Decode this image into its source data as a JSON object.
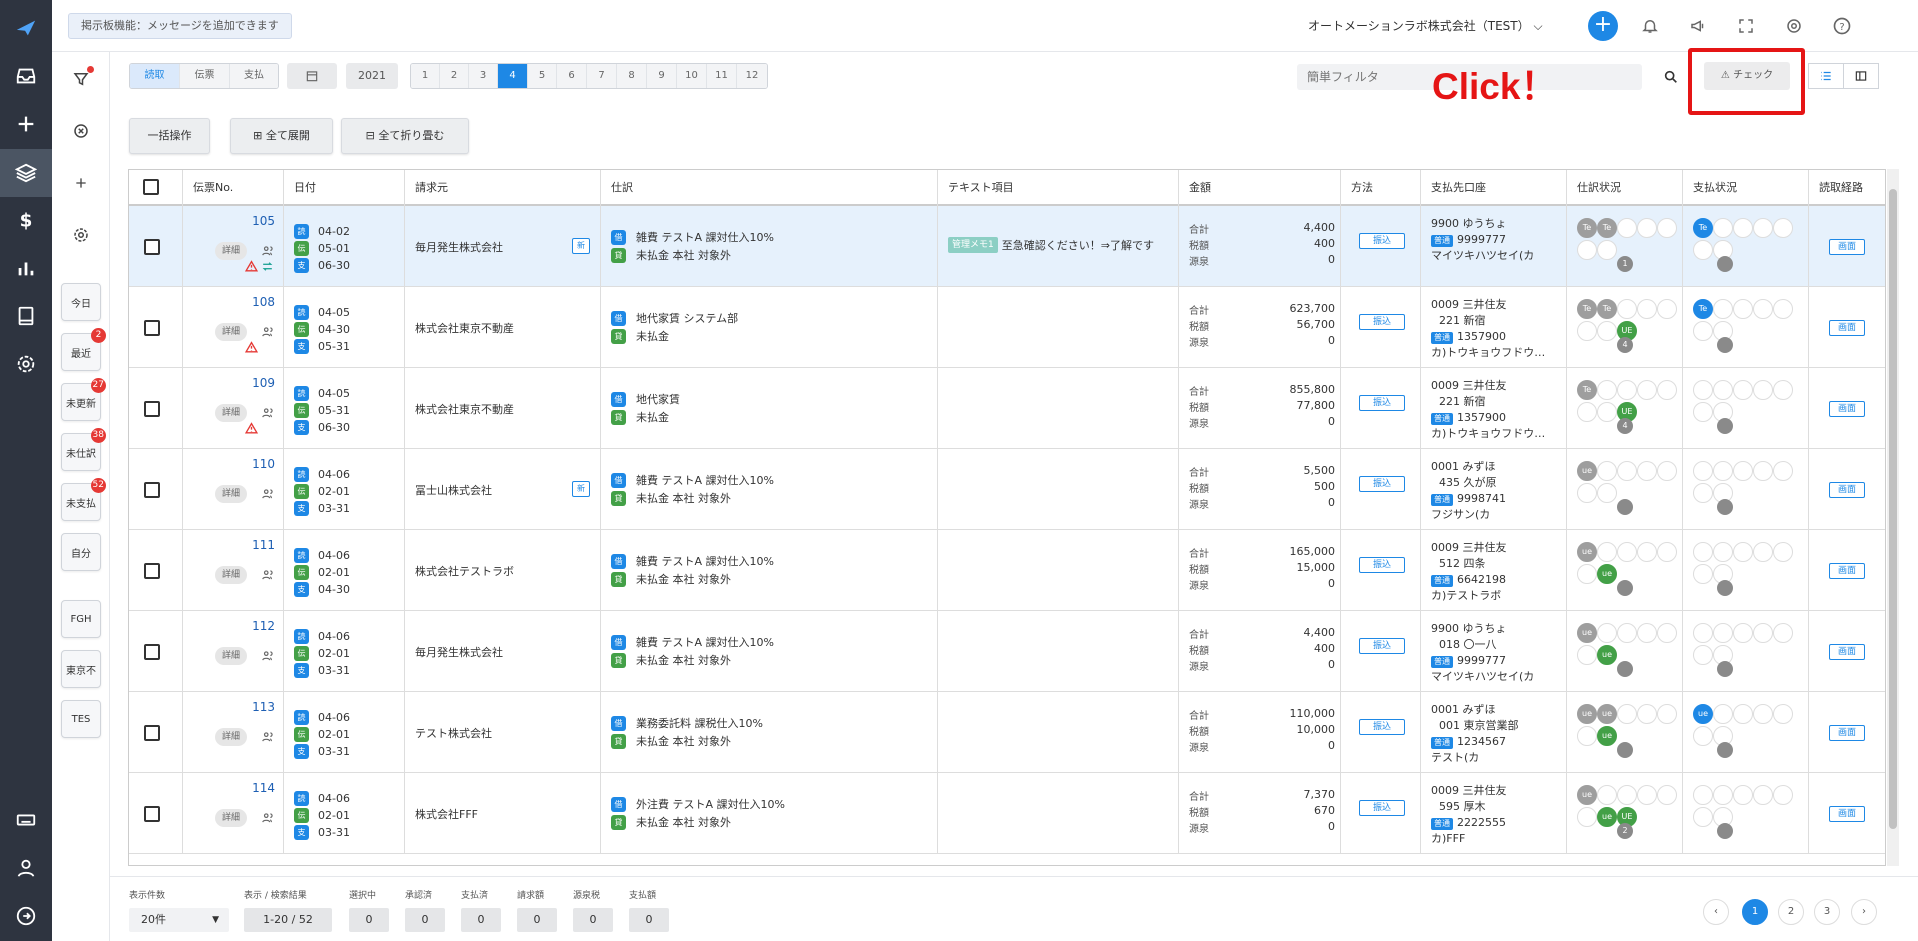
{
  "header": {
    "board_message": "掲示板機能：メッセージを追加できます",
    "company": "オートメーションラボ株式会社（TEST）",
    "plus": "+"
  },
  "side_panel": {
    "buttons": [
      {
        "label": "今日",
        "badge": ""
      },
      {
        "label": "最近",
        "badge": "2"
      },
      {
        "label": "未更新",
        "badge": "27"
      },
      {
        "label": "未仕訳",
        "badge": "38"
      },
      {
        "label": "未支払",
        "badge": "52"
      },
      {
        "label": "自分",
        "badge": ""
      },
      {
        "label": "FGH",
        "badge": ""
      },
      {
        "label": "東京不",
        "badge": ""
      },
      {
        "label": "TES",
        "badge": ""
      }
    ]
  },
  "filter": {
    "types": [
      "読取",
      "伝票",
      "支払"
    ],
    "year": "2021",
    "months": [
      "1",
      "2",
      "3",
      "4",
      "5",
      "6",
      "7",
      "8",
      "9",
      "10",
      "11",
      "12"
    ],
    "selected_month": "4",
    "search_placeholder": "簡単フィルタ",
    "check_label": "⚠ チェック",
    "annotation": "Click！"
  },
  "actions": {
    "bulk": "一括操作",
    "expand_all": "全て展開",
    "collapse_all": "全て折り畳む"
  },
  "columns": [
    "伝票No.",
    "日付",
    "請求元",
    "仕訳",
    "テキスト項目",
    "金額",
    "方法",
    "支払先口座",
    "仕訳状況",
    "支払状況",
    "読取経路"
  ],
  "amount_labels": [
    "合計",
    "税額",
    "源泉"
  ],
  "tag_labels": {
    "read": "読",
    "slip": "伝",
    "pay": "支",
    "debit": "借",
    "credit": "貸"
  },
  "detail_label": "詳細",
  "new_label": "新",
  "futsu_label": "普通",
  "pay_method_label": "振込",
  "screen_label": "画面",
  "rows": [
    {
      "no": "105",
      "warn": true,
      "sync": true,
      "d1": "04-02",
      "d2": "05-01",
      "d3": "06-30",
      "vendor": "毎月発生株式会社",
      "isnew": true,
      "j1": "雑費 テストA 課対仕入10%",
      "j2": "未払金 本社 対象外",
      "memo_tag": "管理メモ1",
      "memo": "至急確認ください！⇒了解です",
      "total": "4,400",
      "tax": "400",
      "wh": "0",
      "a1": "9900 ゆうちょ",
      "a2": "",
      "acct_no": "9999777",
      "a3": "マイツキハツセイ(カ",
      "hl": true
    },
    {
      "no": "108",
      "warn": true,
      "sync": false,
      "d1": "04-05",
      "d2": "04-30",
      "d3": "05-31",
      "vendor": "株式会社東京不動産",
      "isnew": false,
      "j1": "地代家賃 システム部",
      "j2": "未払金",
      "memo_tag": "",
      "memo": "",
      "total": "623,700",
      "tax": "56,700",
      "wh": "0",
      "a1": "0009 三井住友",
      "a2": "221 新宿",
      "acct_no": "1357900",
      "a3": "カ)トウキョウフドウ…",
      "hl": false
    },
    {
      "no": "109",
      "warn": true,
      "sync": false,
      "d1": "04-05",
      "d2": "05-31",
      "d3": "06-30",
      "vendor": "株式会社東京不動産",
      "isnew": false,
      "j1": "地代家賃",
      "j2": "未払金",
      "memo_tag": "",
      "memo": "",
      "total": "855,800",
      "tax": "77,800",
      "wh": "0",
      "a1": "0009 三井住友",
      "a2": "221 新宿",
      "acct_no": "1357900",
      "a3": "カ)トウキョウフドウ…",
      "hl": false
    },
    {
      "no": "110",
      "warn": false,
      "sync": false,
      "d1": "04-06",
      "d2": "02-01",
      "d3": "03-31",
      "vendor": "冨士山株式会社",
      "isnew": true,
      "j1": "雑費 テストA 課対仕入10%",
      "j2": "未払金 本社 対象外",
      "memo_tag": "",
      "memo": "",
      "total": "5,500",
      "tax": "500",
      "wh": "0",
      "a1": "0001 みずほ",
      "a2": "435 久が原",
      "acct_no": "9998741",
      "a3": "フジサン(カ",
      "hl": false
    },
    {
      "no": "111",
      "warn": false,
      "sync": false,
      "d1": "04-06",
      "d2": "02-01",
      "d3": "04-30",
      "vendor": "株式会社テストラボ",
      "isnew": false,
      "j1": "雑費 テストA 課対仕入10%",
      "j2": "未払金 本社 対象外",
      "memo_tag": "",
      "memo": "",
      "total": "165,000",
      "tax": "15,000",
      "wh": "0",
      "a1": "0009 三井住友",
      "a2": "512 四条",
      "acct_no": "6642198",
      "a3": "カ)テストラボ",
      "hl": false
    },
    {
      "no": "112",
      "warn": false,
      "sync": false,
      "d1": "04-06",
      "d2": "02-01",
      "d3": "03-31",
      "vendor": "毎月発生株式会社",
      "isnew": false,
      "j1": "雑費 テストA 課対仕入10%",
      "j2": "未払金 本社 対象外",
      "memo_tag": "",
      "memo": "",
      "total": "4,400",
      "tax": "400",
      "wh": "0",
      "a1": "9900 ゆうちょ",
      "a2": "018 〇一八",
      "acct_no": "9999777",
      "a3": "マイツキハツセイ(カ",
      "hl": false
    },
    {
      "no": "113",
      "warn": false,
      "sync": false,
      "d1": "04-06",
      "d2": "02-01",
      "d3": "03-31",
      "vendor": "テスト株式会社",
      "isnew": false,
      "j1": "業務委託料 課税仕入10%",
      "j2": "未払金 本社 対象外",
      "memo_tag": "",
      "memo": "",
      "total": "110,000",
      "tax": "10,000",
      "wh": "0",
      "a1": "0001 みずほ",
      "a2": "001 東京営業部",
      "acct_no": "1234567",
      "a3": "テスト(カ",
      "hl": false
    },
    {
      "no": "114",
      "warn": false,
      "sync": false,
      "d1": "04-06",
      "d2": "02-01",
      "d3": "03-31",
      "vendor": "株式会社FFF",
      "isnew": false,
      "j1": "外注費 テストA 課対仕入10%",
      "j2": "未払金 本社 対象外",
      "memo_tag": "",
      "memo": "",
      "total": "7,370",
      "tax": "670",
      "wh": "0",
      "a1": "0009 三井住友",
      "a2": "595 厚木",
      "acct_no": "2222555",
      "a3": "カ)FFF",
      "hl": false
    }
  ],
  "footer": {
    "per_page_label": "表示件数",
    "per_page_value": "20件",
    "result_label": "表示 / 検索結果",
    "result_value": "1-20 / 52",
    "stats": [
      {
        "label": "選択中",
        "value": "0"
      },
      {
        "label": "承認済",
        "value": "0"
      },
      {
        "label": "支払済",
        "value": "0"
      },
      {
        "label": "請求額",
        "value": "0"
      },
      {
        "label": "源泉税",
        "value": "0"
      },
      {
        "label": "支払額",
        "value": "0"
      }
    ],
    "pages": [
      "1",
      "2",
      "3"
    ],
    "current_page": "1",
    "prev": "‹",
    "next": "›"
  },
  "colors": {
    "accent": "#1e88e5",
    "rail": "#2e3440",
    "highlight_row": "#e6f1fc",
    "annotation": "#e51515"
  }
}
